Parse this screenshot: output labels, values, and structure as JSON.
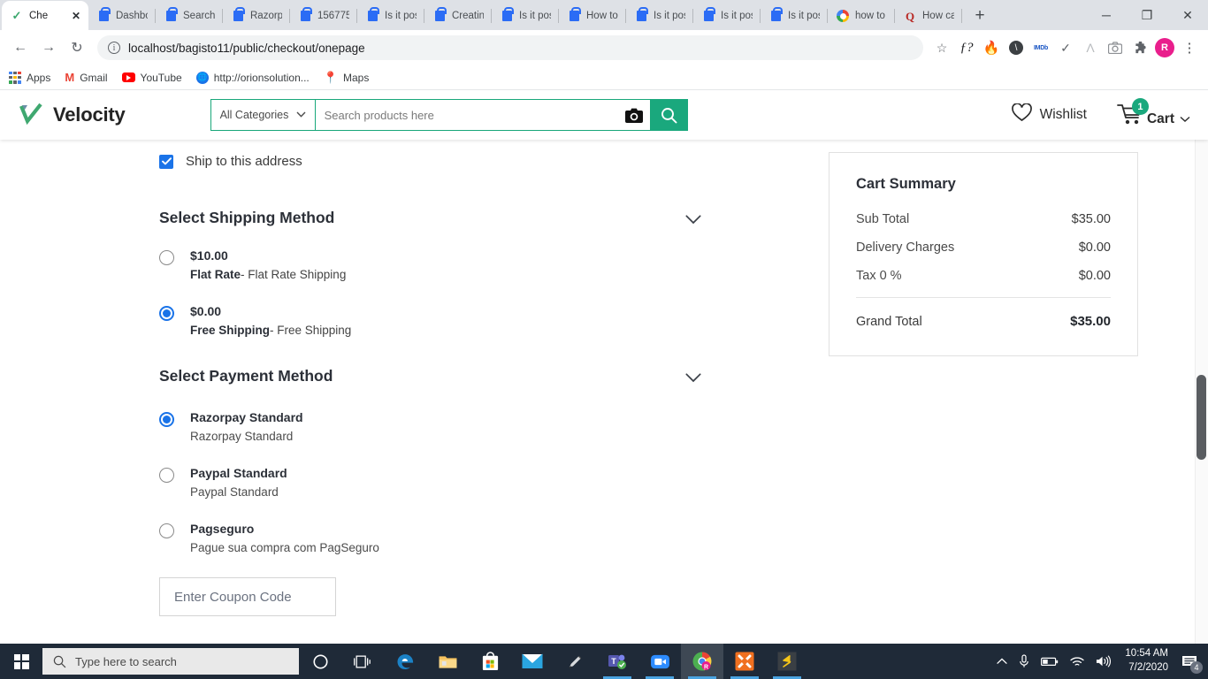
{
  "browser": {
    "tabs": [
      {
        "title": "Che",
        "favicon": "check-icon",
        "active": true
      },
      {
        "title": "Dashbo",
        "favicon": "lock-icon",
        "active": false
      },
      {
        "title": "Search",
        "favicon": "lock-icon",
        "active": false
      },
      {
        "title": "Razorpa",
        "favicon": "lock-icon",
        "active": false
      },
      {
        "title": "156775",
        "favicon": "lock-icon",
        "active": false
      },
      {
        "title": "Is it pos",
        "favicon": "lock-icon",
        "active": false
      },
      {
        "title": "Creating",
        "favicon": "lock-icon",
        "active": false
      },
      {
        "title": "Is it pos",
        "favicon": "lock-icon",
        "active": false
      },
      {
        "title": "How to",
        "favicon": "lock-icon",
        "active": false
      },
      {
        "title": "Is it pos",
        "favicon": "lock-icon",
        "active": false
      },
      {
        "title": "Is it pos",
        "favicon": "lock-icon",
        "active": false
      },
      {
        "title": "Is it pos",
        "favicon": "lock-icon",
        "active": false
      },
      {
        "title": "how to",
        "favicon": "google-icon",
        "active": false
      },
      {
        "title": "How ca",
        "favicon": "quora-icon",
        "active": false
      }
    ],
    "new_tab_label": "+",
    "close_tab_label": "✕",
    "window_controls": {
      "minimize": "─",
      "maximize": "❐",
      "close": "✕"
    },
    "nav": {
      "back": "←",
      "forward": "→",
      "reload": "↻"
    },
    "omnibox": {
      "url": "localhost/bagisto11/public/checkout/onepage",
      "info_icon": "ⓘ"
    },
    "toolbar_icons": [
      {
        "name": "bookmark-star-icon",
        "glyph": "☆"
      },
      {
        "name": "fonts-ninja-icon",
        "glyph": "ƒ?"
      },
      {
        "name": "hotjar-icon",
        "glyph": "🔥"
      },
      {
        "name": "adblock-icon",
        "glyph": "⊘"
      },
      {
        "name": "imdb-icon",
        "glyph": "IMDb"
      },
      {
        "name": "grammarly-icon",
        "glyph": "✓"
      },
      {
        "name": "awesome-screenshot-icon",
        "glyph": "Λ"
      },
      {
        "name": "camera-capture-icon",
        "glyph": "📷"
      },
      {
        "name": "extensions-puzzle-icon",
        "glyph": "❖"
      },
      {
        "name": "profile-avatar",
        "glyph": "R"
      },
      {
        "name": "chrome-menu-icon",
        "glyph": "⋮"
      }
    ],
    "bookmarks": [
      {
        "label": "Apps",
        "icon": "apps-grid-icon"
      },
      {
        "label": "Gmail",
        "icon": "gmail-icon"
      },
      {
        "label": "YouTube",
        "icon": "youtube-icon"
      },
      {
        "label": "http://orionsolution...",
        "icon": "globe-icon"
      },
      {
        "label": "Maps",
        "icon": "maps-pin-icon"
      }
    ]
  },
  "site_header": {
    "logo_text": "Velocity",
    "category_select": {
      "value": "All Categories",
      "chevron": "⌄"
    },
    "search": {
      "placeholder": "Search products here",
      "value": ""
    },
    "wishlist_label": "Wishlist",
    "cart_label": "Cart",
    "cart_count": "1",
    "cart_chevron": "⌄"
  },
  "checkout": {
    "ship_to_address_label": "Ship to this address",
    "ship_to_address_checked": true,
    "shipping": {
      "title": "Select Shipping Method",
      "methods": [
        {
          "price": "$10.00",
          "name": "Flat Rate",
          "description": "- Flat Rate Shipping",
          "selected": false
        },
        {
          "price": "$0.00",
          "name": "Free Shipping",
          "description": "- Free Shipping",
          "selected": true
        }
      ]
    },
    "payment": {
      "title": "Select Payment Method",
      "methods": [
        {
          "title": "Razorpay Standard",
          "description": "Razorpay Standard",
          "selected": true
        },
        {
          "title": "Paypal Standard",
          "description": "Paypal Standard",
          "selected": false
        },
        {
          "title": "Pagseguro",
          "description": "Pague sua compra com PagSeguro",
          "selected": false
        }
      ]
    },
    "coupon": {
      "placeholder": "Enter Coupon Code",
      "value": ""
    },
    "cart_summary": {
      "title": "Cart Summary",
      "rows": [
        {
          "label": "Sub Total",
          "value": "$35.00"
        },
        {
          "label": "Delivery Charges",
          "value": "$0.00"
        },
        {
          "label": "Tax 0 %",
          "value": "$0.00"
        }
      ],
      "grand_total": {
        "label": "Grand Total",
        "value": "$35.00"
      }
    }
  },
  "taskbar": {
    "search_placeholder": "Type here to search",
    "items": [
      {
        "name": "cortana-icon"
      },
      {
        "name": "task-view-icon"
      },
      {
        "name": "microsoft-edge-icon"
      },
      {
        "name": "file-explorer-icon"
      },
      {
        "name": "microsoft-store-icon"
      },
      {
        "name": "mail-icon"
      },
      {
        "name": "snip-tool-icon"
      },
      {
        "name": "microsoft-teams-icon"
      },
      {
        "name": "zoom-icon"
      },
      {
        "name": "google-chrome-icon"
      },
      {
        "name": "xampp-icon"
      },
      {
        "name": "sublime-text-icon"
      }
    ],
    "tray": {
      "show_hidden": "∧",
      "microphone": "🎙",
      "battery": "▭",
      "wifi": "◠",
      "volume": "🔊",
      "time": "10:54 AM",
      "date": "7/2/2020",
      "notification_count": "4"
    }
  },
  "colors": {
    "brand_green": "#1aa87d",
    "radio_blue": "#1a73e8",
    "checkbox_blue": "#1a73e8",
    "taskbar": "#1f2a38",
    "laravel_red": "#f4645f"
  }
}
